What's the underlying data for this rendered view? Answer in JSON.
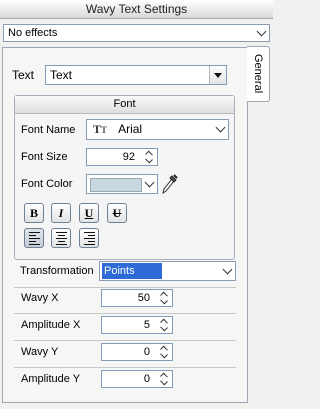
{
  "window": {
    "title": "Wavy Text Settings"
  },
  "effects": {
    "value": "No effects"
  },
  "tab": {
    "label": "General"
  },
  "text_field": {
    "label": "Text",
    "value": "Text"
  },
  "font": {
    "group_title": "Font",
    "name_label": "Font Name",
    "name_value": "Arial",
    "size_label": "Font Size",
    "size_value": "92",
    "color_label": "Font Color",
    "color_value": "#c9d7e0",
    "bold": "B",
    "italic": "I",
    "underline": "U",
    "strikeout": "U",
    "alignment_selected": "left"
  },
  "transformation": {
    "label": "Transformation",
    "value": "Points"
  },
  "params": [
    {
      "label": "Wavy X",
      "value": "50"
    },
    {
      "label": "Amplitude X",
      "value": "5"
    },
    {
      "label": "Wavy Y",
      "value": "0"
    },
    {
      "label": "Amplitude Y",
      "value": "0"
    }
  ],
  "colors": {
    "selection": "#2e6bd6",
    "border": "#9da6b3"
  }
}
